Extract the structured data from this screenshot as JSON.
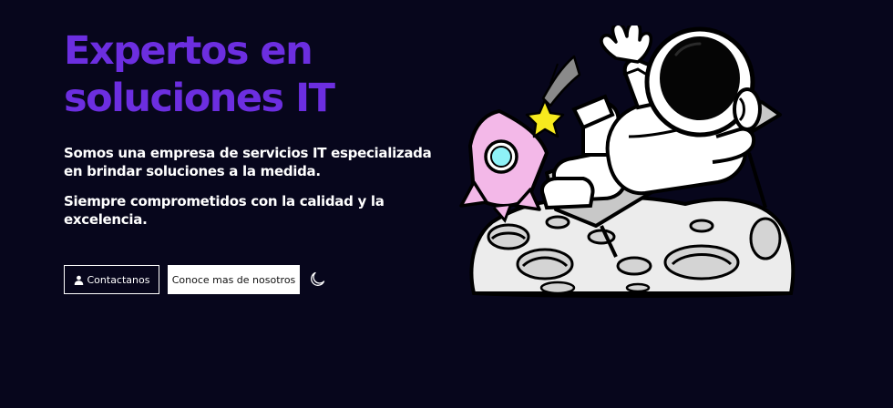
{
  "hero": {
    "title_line1": "Expertos en",
    "title_line2": "soluciones IT",
    "description_1": "Somos una empresa de servicios IT especializada en brindar soluciones a la medida.",
    "description_2": "Siempre comprometidos con la calidad y la excelencia."
  },
  "buttons": {
    "contact_label": "Contactanos",
    "contact_icon": "user-icon",
    "about_label": "Conoce mas de nosotros"
  },
  "theme_toggle": {
    "icon": "moon-icon"
  },
  "illustration": {
    "subject": "astronaut-on-moon",
    "accent_colors": {
      "rocket": "#f3b8e8",
      "star": "#f7ea1e",
      "window": "#8ef2f7"
    }
  },
  "colors": {
    "background": "#07061c",
    "title": "#6c2ee0",
    "text": "#ffffff"
  }
}
